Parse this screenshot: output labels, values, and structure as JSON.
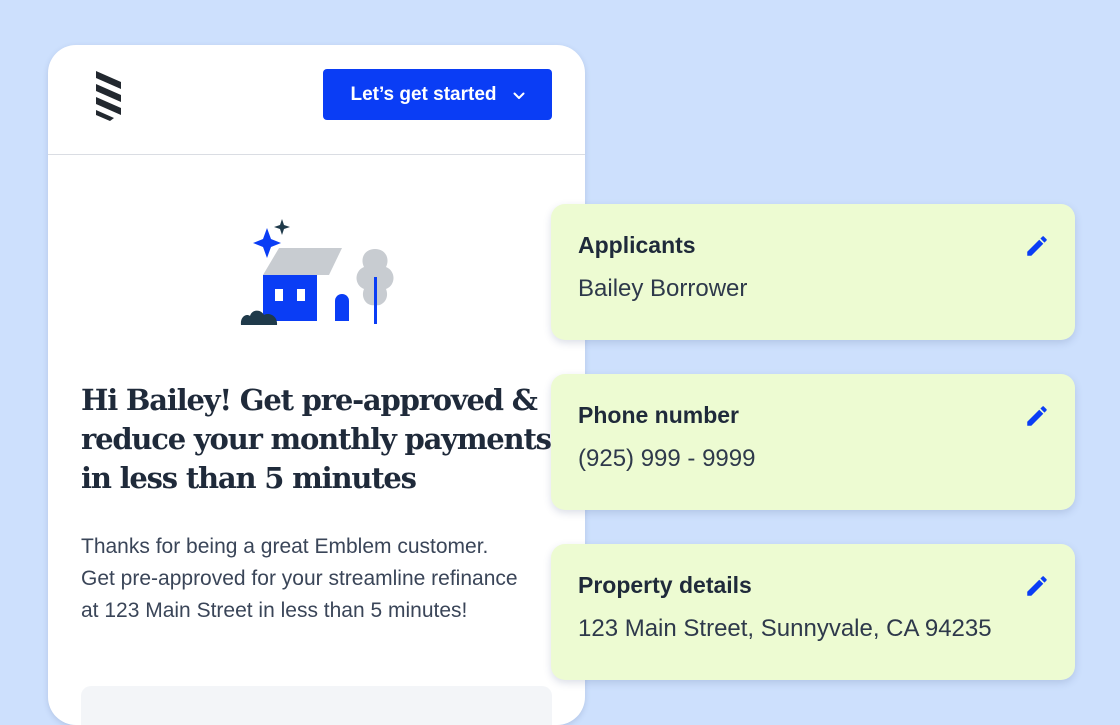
{
  "header": {
    "cta_label": "Let’s get started",
    "logo_icon": "emblem-logo-icon",
    "chevron_icon": "chevron-down-icon"
  },
  "hero": {
    "illustration_icon": "house-with-sparkles-illustration",
    "headline": "Hi Bailey! Get pre-approved & reduce your monthly payments in less than 5 minutes",
    "body": "Thanks for being a great Emblem customer. Get pre-approved for your streamline refinance at 123 Main Street in less than 5 minutes!"
  },
  "cards": [
    {
      "label": "Applicants",
      "value": "Bailey Borrower",
      "icon": "pencil-edit-icon"
    },
    {
      "label": "Phone number",
      "value": "(925) 999 - 9999",
      "icon": "pencil-edit-icon"
    },
    {
      "label": "Property details",
      "value": "123 Main Street, Sunnyvale, CA 94235",
      "icon": "pencil-edit-icon"
    }
  ],
  "colors": {
    "background": "#cde0fd",
    "primary": "#0a3df5",
    "card_background": "#edfbd2",
    "text_dark": "#1f2a3a"
  }
}
